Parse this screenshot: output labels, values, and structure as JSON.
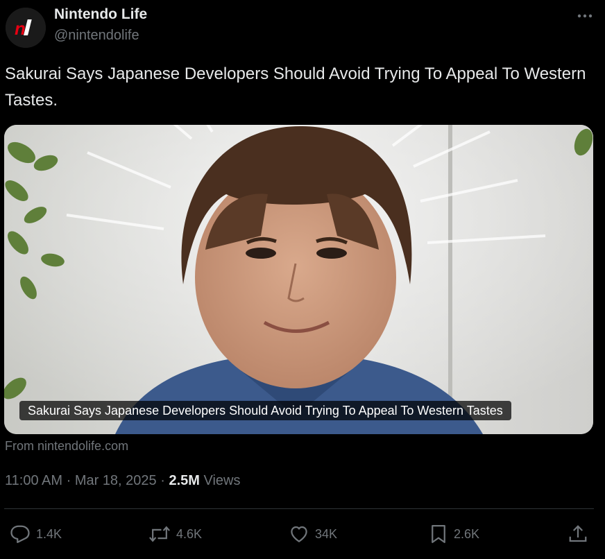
{
  "author": {
    "name": "Nintendo Life",
    "handle": "@nintendolife",
    "avatar_text": "nl",
    "avatar_color": "#e60012"
  },
  "post": {
    "text": "Sakurai Says Japanese Developers Should Avoid Trying To Appeal To Western Tastes.",
    "media_caption": "Sakurai Says Japanese Developers Should Avoid Trying To Appeal To Western Tastes",
    "source": "From nintendolife.com",
    "time": "11:00 AM",
    "date": "Mar 18, 2025",
    "views_count": "2.5M",
    "views_label": "Views"
  },
  "actions": {
    "reply": {
      "icon": "reply-icon",
      "count": "1.4K"
    },
    "repost": {
      "icon": "repost-icon",
      "count": "4.6K"
    },
    "like": {
      "icon": "heart-icon",
      "count": "34K"
    },
    "bookmark": {
      "icon": "bookmark-icon",
      "count": "2.6K"
    },
    "share": {
      "icon": "share-icon"
    }
  },
  "colors": {
    "background": "#000000",
    "text_primary": "#e7e9ea",
    "text_secondary": "#71767b",
    "divider": "#2f3336"
  }
}
